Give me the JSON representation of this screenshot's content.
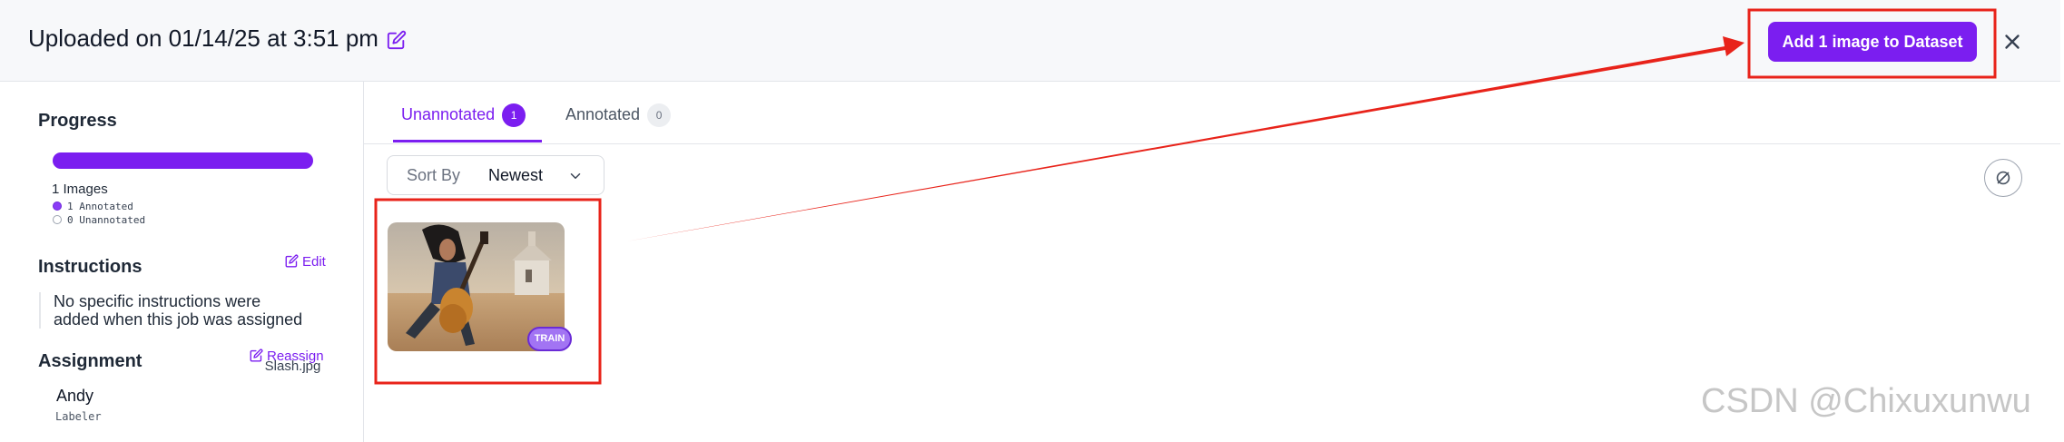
{
  "header": {
    "title": "Uploaded on 01/14/25 at 3:51 pm",
    "add_button_label": "Add 1 image to Dataset"
  },
  "sidebar": {
    "progress": {
      "heading": "Progress",
      "fraction_annotated": 1.0,
      "images_label": "1 Images",
      "annotated_label": "1 Annotated",
      "unannotated_label": "0 Unannotated"
    },
    "instructions": {
      "heading": "Instructions",
      "edit_label": "Edit",
      "text_line1": "No specific instructions were",
      "text_line2": "added when this job was assigned"
    },
    "assignment": {
      "heading": "Assignment",
      "reassign_label": "Reassign",
      "assignee_name": "Andy",
      "assignee_role": "Labeler"
    }
  },
  "main": {
    "tabs": [
      {
        "label": "Unannotated",
        "count": "1"
      },
      {
        "label": "Annotated",
        "count": "0"
      }
    ],
    "sort": {
      "label": "Sort By",
      "value": "Newest"
    },
    "images": [
      {
        "filename": "Slash.jpg",
        "split_badge": "TRAIN"
      }
    ]
  },
  "watermark": "CSDN @Chixuxunwu",
  "colors": {
    "accent": "#7b1ef0",
    "annotation_red": "#e8231a"
  },
  "icons": [
    "edit-icon",
    "close-icon",
    "chevron-down-icon",
    "eye-off-icon"
  ]
}
